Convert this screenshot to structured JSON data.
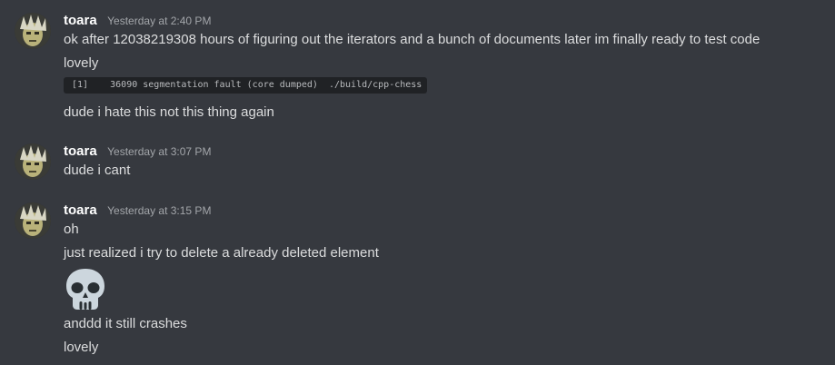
{
  "messages": [
    {
      "username": "toara",
      "timestamp": "Yesterday at 2:40 PM",
      "lines": [
        "ok after 12038219308 hours of figuring out the iterators and a bunch of documents later im finally ready to test code",
        "lovely"
      ],
      "code": "[1]    36090 segmentation fault (core dumped)  ./build/cpp-chess",
      "after_code": "dude i hate this not this thing again"
    },
    {
      "username": "toara",
      "timestamp": "Yesterday at 3:07 PM",
      "lines": [
        "dude i cant"
      ]
    },
    {
      "username": "toara",
      "timestamp": "Yesterday at 3:15 PM",
      "lines": [
        "oh",
        "just realized i try to delete a already deleted element"
      ],
      "emoji": "skull-emoji",
      "after_emoji": [
        "anddd it still crashes",
        "lovely"
      ]
    }
  ],
  "colors": {
    "background": "#36393f",
    "text": "#dcddde",
    "username": "#ffffff",
    "timestamp": "#a3a6aa",
    "code_background": "#202225"
  }
}
